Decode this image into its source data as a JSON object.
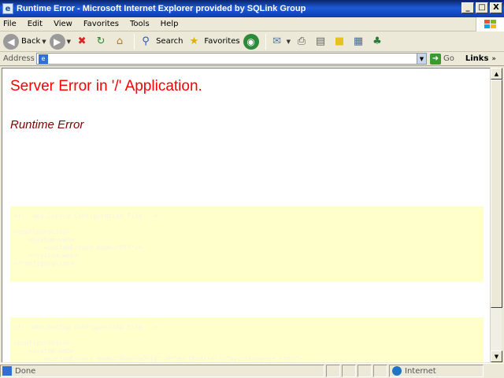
{
  "window": {
    "title": "Runtime Error - Microsoft Internet Explorer provided by SQLink Group",
    "controls": [
      "_",
      "□",
      "X"
    ]
  },
  "menu": {
    "items": [
      "File",
      "Edit",
      "View",
      "Favorites",
      "Tools",
      "Help"
    ]
  },
  "toolbar": {
    "back_label": "Back",
    "search_label": "Search",
    "favorites_label": "Favorites"
  },
  "address": {
    "label": "Address",
    "value": "",
    "go_label": "Go",
    "links_label": "Links"
  },
  "page": {
    "heading": "Server Error in '/' Application.",
    "subheading": "Runtime Error",
    "code1": "<!-- Web.Config Configuration File -->\n\n<configuration>\n    <system.web>\n        <customErrors mode=\"Off\"/>\n    </system.web>\n</configuration>",
    "code2": "<!-- Web.Config Configuration File -->\n\n<configuration>\n    <system.web>\n        <customErrors mode=\"RemoteOnly\" defaultRedirect=\"mycustompage.htm\"/>"
  },
  "status": {
    "text": "Done",
    "zone": "Internet"
  },
  "colors": {
    "heading": "#ff0000",
    "subheading": "#800000",
    "codebox_bg": "#ffffcc"
  }
}
